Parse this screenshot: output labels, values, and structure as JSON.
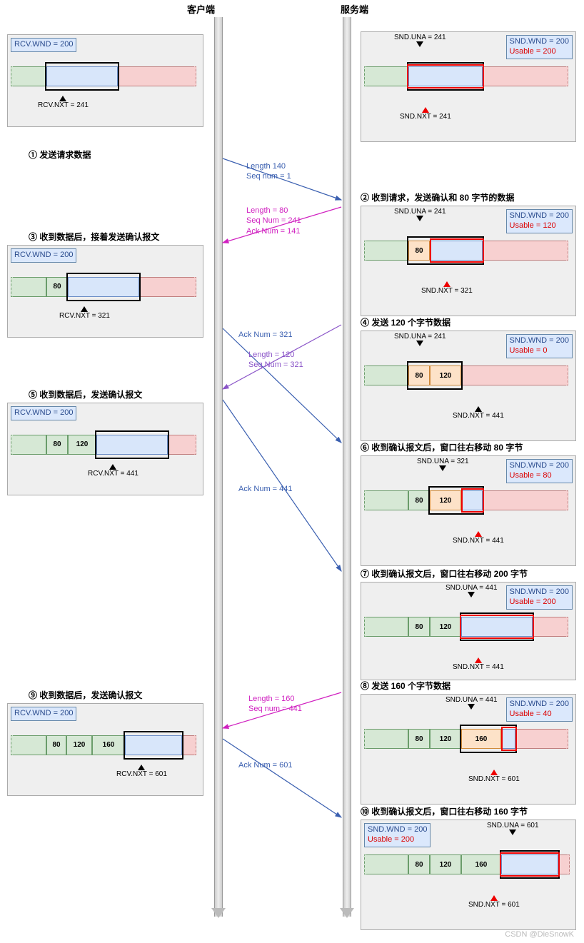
{
  "headers": {
    "client": "客户端",
    "server": "服务端"
  },
  "watermark": "CSDN @DieSnowK",
  "labels": {
    "rcv_wnd": "RCV.WND = 200",
    "snd_wnd": "SND.WND = 200",
    "usable200": "Usable = 200",
    "usable120": "Usable = 120",
    "usable0": "Usable = 0",
    "usable80": "Usable = 80",
    "usable40": "Usable = 40"
  },
  "client": {
    "p0": {
      "rcv_nxt": "RCV.NXT = 241"
    },
    "p3": {
      "rcv_nxt": "RCV.NXT = 321",
      "seg": "80"
    },
    "p5": {
      "rcv_nxt": "RCV.NXT = 441",
      "segs": [
        "80",
        "120"
      ]
    },
    "p9": {
      "rcv_nxt": "RCV.NXT = 601",
      "segs": [
        "80",
        "120",
        "160"
      ]
    }
  },
  "server": {
    "p0": {
      "una": "SND.UNA = 241",
      "nxt": "SND.NXT = 241"
    },
    "p2": {
      "una": "SND.UNA = 241",
      "nxt": "SND.NXT = 321",
      "seg": "80"
    },
    "p4": {
      "una": "SND.UNA = 241",
      "nxt": "SND.NXT = 441",
      "segs": [
        "80",
        "120"
      ]
    },
    "p6": {
      "una": "SND.UNA = 321",
      "nxt": "SND.NXT = 441",
      "segs": [
        "80",
        "120"
      ]
    },
    "p7": {
      "una": "SND.UNA = 441",
      "nxt": "SND.NXT = 441",
      "segs": [
        "80",
        "120"
      ]
    },
    "p8": {
      "una": "SND.UNA = 441",
      "nxt": "SND.NXT = 601",
      "segs": [
        "80",
        "120",
        "160"
      ]
    },
    "p10": {
      "una": "SND.UNA = 601",
      "nxt": "SND.NXT = 601",
      "segs": [
        "80",
        "120",
        "160"
      ]
    }
  },
  "steps": {
    "s1": "① 发送请求数据",
    "s2": "② 收到请求，发送确认和 80 字节的数据",
    "s3": "③ 收到数据后，接着发送确认报文",
    "s4": "④ 发送 120 个字节数据",
    "s5": "⑤ 收到数据后，发送确认报文",
    "s6": "⑥ 收到确认报文后，窗口往右移动 80 字节",
    "s7": "⑦ 收到确认报文后，窗口往右移动 200 字节",
    "s8": "⑧ 发送 160 个字节数据",
    "s9": "⑨ 收到数据后，发送确认报文",
    "s10": "⑩ 收到确认报文后，窗口往右移动 160 字节"
  },
  "msgs": {
    "m1a": "Length 140",
    "m1b": "Seq num = 1",
    "m2a": "Length = 80",
    "m2b": "Seq Num = 241",
    "m2c": "Ack Num = 141",
    "m3": "Ack Num = 321",
    "m4a": "Length = 120",
    "m4b": "Seq Num = 321",
    "m5": "Ack Num = 441",
    "m8a": "Length = 160",
    "m8b": "Seq num = 441",
    "m9": "Ack Num = 601"
  }
}
